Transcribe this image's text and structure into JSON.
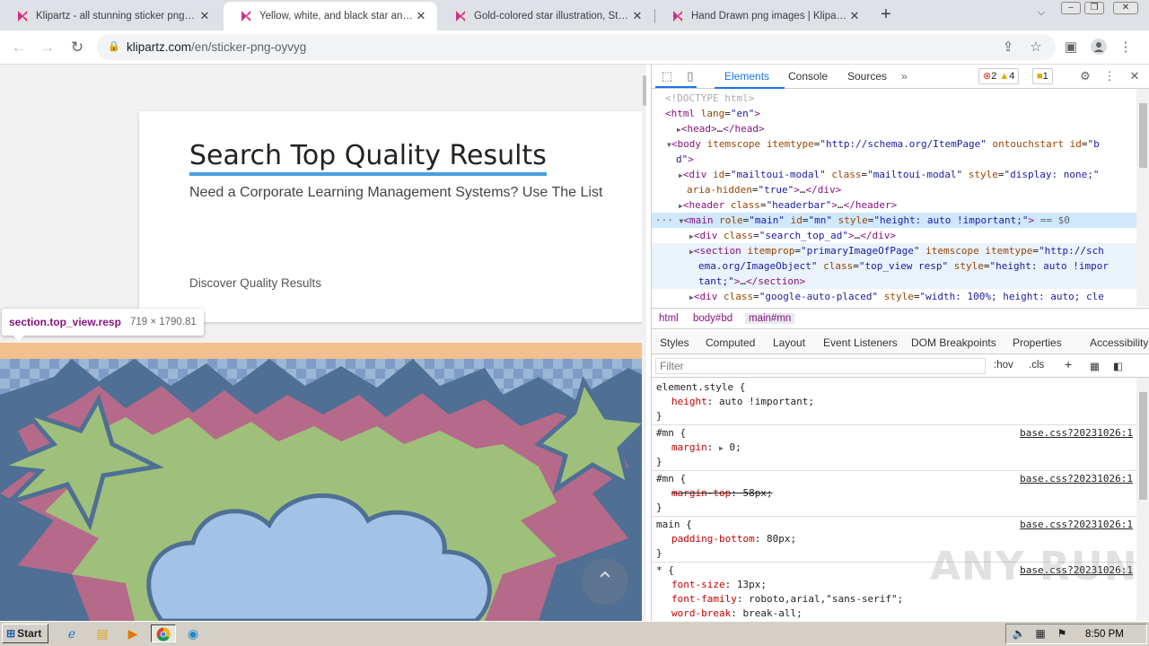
{
  "browser": {
    "tabs": [
      {
        "title": "Klipartz - all stunning sticker png ima",
        "active": false
      },
      {
        "title": "Yellow, white, and black star and clo",
        "active": true
      },
      {
        "title": "Gold-colored star illustration, Star Dr",
        "active": false
      },
      {
        "title": "Hand Drawn png images | Klipartz",
        "active": false
      }
    ],
    "new_tab": "+",
    "url_host": "klipartz.com",
    "url_path": "/en/sticker-png-oyvyg"
  },
  "page": {
    "title": "Search Top Quality Results",
    "subtitle": "Need a Corporate Learning Management Systems? Use The List",
    "discover": "Discover Quality Results",
    "tooltip_selector": "section.top_view.resp",
    "tooltip_dims": "719 × 1790.81"
  },
  "devtools": {
    "tabs": [
      "Elements",
      "Console",
      "Sources"
    ],
    "errors": "2",
    "warnings": "4",
    "issues": "1",
    "breadcrumbs": [
      "html",
      "body#bd",
      "main#mn"
    ],
    "styles_tabs": [
      "Styles",
      "Computed",
      "Layout",
      "Event Listeners",
      "DOM Breakpoints",
      "Properties",
      "Accessibility"
    ],
    "filter_placeholder": "Filter",
    "hov": ":hov",
    "cls": ".cls"
  },
  "taskbar": {
    "start": "Start",
    "clock": "8:50 PM"
  },
  "watermark": "ANY RUN"
}
